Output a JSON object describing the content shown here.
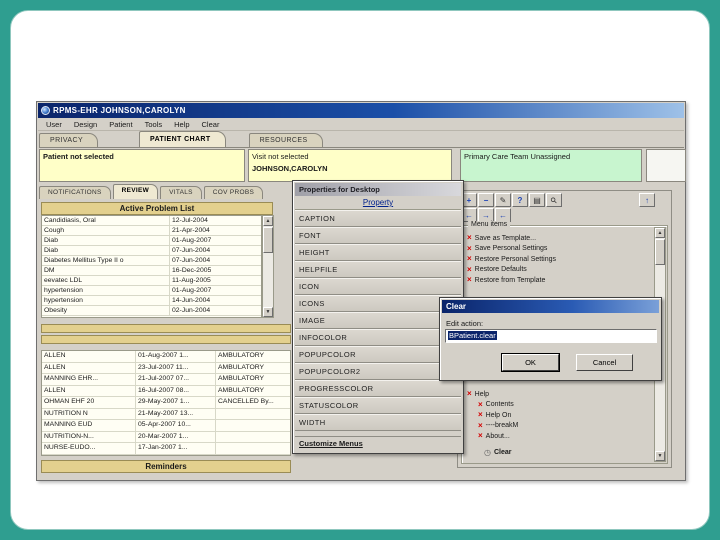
{
  "window": {
    "title": "RPMS-EHR JOHNSON,CAROLYN",
    "menu": [
      "User",
      "Design",
      "Patient",
      "Tools",
      "Help",
      "Clear"
    ]
  },
  "top_tabs": [
    {
      "label": "PRIVACY",
      "active": false
    },
    {
      "label": "PATIENT CHART",
      "active": true
    },
    {
      "label": "RESOURCES",
      "active": false
    }
  ],
  "banners": {
    "patient": "Patient not selected",
    "visit_line1": "Visit not selected",
    "visit_line2": "JOHNSON,CAROLYN",
    "team": "Primary Care Team Unassigned"
  },
  "chart_tabs": [
    {
      "label": "NOTIFICATIONS",
      "active": false
    },
    {
      "label": "REVIEW",
      "active": true
    },
    {
      "label": "VITALS",
      "active": false
    },
    {
      "label": "COV PROBS",
      "active": false
    }
  ],
  "problem_list": {
    "title": "Active Problem List",
    "rows": [
      {
        "name": "Candidiasis, Oral",
        "date": "12-Jul-2004"
      },
      {
        "name": "Cough",
        "date": "21-Apr-2004"
      },
      {
        "name": "Diab",
        "date": "01-Aug-2007"
      },
      {
        "name": "Diab",
        "date": "07-Jun-2004"
      },
      {
        "name": "Diabetes Mellitus Type II o",
        "date": "07-Jun-2004"
      },
      {
        "name": "DM",
        "date": "16-Dec-2005"
      },
      {
        "name": "eevatec LDL",
        "date": "11-Aug-2005"
      },
      {
        "name": "hypertension",
        "date": "01-Aug-2007"
      },
      {
        "name": "hypertension",
        "date": "14-Jun-2004"
      },
      {
        "name": "Obesity",
        "date": "02-Jun-2004"
      }
    ]
  },
  "visits": {
    "rows": [
      {
        "name": "ALLEN",
        "date": "01-Aug-2007 1...",
        "type": "AMBULATORY"
      },
      {
        "name": "ALLEN",
        "date": "23-Jul-2007 11...",
        "type": "AMBULATORY"
      },
      {
        "name": "MANNING EHR...",
        "date": "21-Jul-2007 07...",
        "type": "AMBULATORY"
      },
      {
        "name": "ALLEN",
        "date": "16-Jul-2007 08...",
        "type": "AMBULATORY"
      },
      {
        "name": "OHMAN EHF 20",
        "date": "29-May-2007 1...",
        "type": "CANCELLED By..."
      },
      {
        "name": "NUTRITION N",
        "date": "21-May-2007 13...",
        "type": ""
      },
      {
        "name": "MANNING EUD",
        "date": "05-Apr-2007 10...",
        "type": ""
      },
      {
        "name": "NUTRITION-N...",
        "date": "20-Mar-2007 1...",
        "type": ""
      },
      {
        "name": "NURSE-EUDO...",
        "date": "17-Jan-2007 1...",
        "type": ""
      }
    ]
  },
  "reminders": {
    "title": "Reminders"
  },
  "properties_dialog": {
    "title": "Properties for Desktop",
    "column_header": "Property",
    "rows": [
      "CAPTION",
      "FONT",
      "HEIGHT",
      "HELPFILE",
      "ICON",
      "ICONS",
      "IMAGE",
      "INFOCOLOR",
      "POPUPCOLOR",
      "POPUPCOLOR2",
      "PROGRESSCOLOR",
      "STATUSCOLOR",
      "WIDTH"
    ],
    "footer": "Customize Menus"
  },
  "menu_editor": {
    "group_label": "Menu items",
    "items_top": [
      {
        "label": "Save as Template...",
        "indent": 0
      },
      {
        "label": "Save Personal Settings",
        "indent": 0
      },
      {
        "label": "Restore Personal Settings",
        "indent": 0
      },
      {
        "label": "Restore Defaults",
        "indent": 0
      },
      {
        "label": "Restore from Template",
        "indent": 0
      }
    ],
    "items_bottom": [
      {
        "label": "Help",
        "indent": 0
      },
      {
        "label": "Contents",
        "indent": 1
      },
      {
        "label": "Help On",
        "indent": 1
      },
      {
        "label": "----breakM",
        "indent": 1
      },
      {
        "label": "About...",
        "indent": 1
      }
    ],
    "selected_action": "Clear"
  },
  "clear_dialog": {
    "title": "Clear",
    "label": "Edit action:",
    "value": "BPatient.clear",
    "ok": "OK",
    "cancel": "Cancel"
  },
  "icons": {
    "plus": "+",
    "minus": "−",
    "arrow_left": "←",
    "arrow_right": "→",
    "arrow_up": "↑",
    "pencil": "✎",
    "help": "?",
    "printer": "▤",
    "magnifier": "⚲",
    "scroll_up": "▲",
    "scroll_down": "▼",
    "delete": "×",
    "clock": "◷"
  },
  "colors": {
    "teal_background": "#2f9e90",
    "banner_yellow": "#ffffc8",
    "banner_green": "#c8f5cf",
    "header_tan": "#e3d08e",
    "titlebar_blue": "#0a246a"
  }
}
